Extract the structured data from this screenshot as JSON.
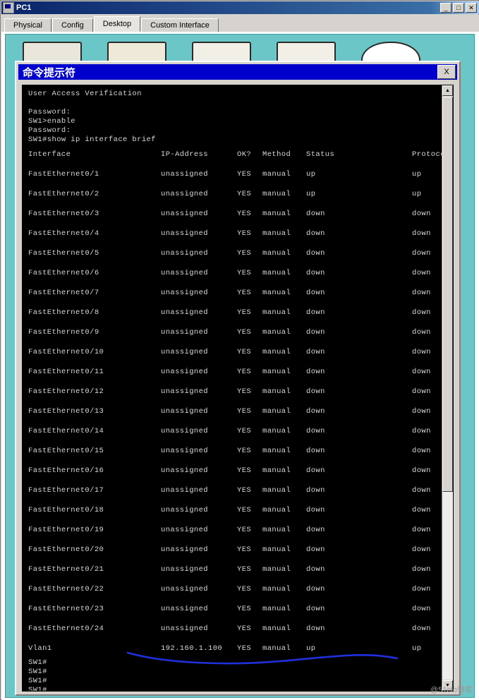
{
  "window": {
    "title": "PC1",
    "buttons": {
      "minimize": "_",
      "maximize": "□",
      "close": "✕"
    }
  },
  "tabs": [
    {
      "label": "Physical",
      "active": false
    },
    {
      "label": "Config",
      "active": false
    },
    {
      "label": "Desktop",
      "active": true
    },
    {
      "label": "Custom Interface",
      "active": false
    }
  ],
  "cmd": {
    "title": "命令提示符",
    "close_label": "X",
    "scroll": {
      "up": "▲",
      "down": "▼"
    }
  },
  "console": {
    "header_lines": [
      "User Access Verification",
      "",
      "Password:",
      "SW1>enable",
      "Password:",
      "SW1#show ip interface brief"
    ],
    "columns": [
      "Interface",
      "IP-Address",
      "OK?",
      "Method",
      "Status",
      "Protocol"
    ],
    "rows": [
      {
        "interface": "FastEthernet0/1",
        "ip": "unassigned",
        "ok": "YES",
        "method": "manual",
        "status": "up",
        "protocol": "up"
      },
      {
        "interface": "FastEthernet0/2",
        "ip": "unassigned",
        "ok": "YES",
        "method": "manual",
        "status": "up",
        "protocol": "up"
      },
      {
        "interface": "FastEthernet0/3",
        "ip": "unassigned",
        "ok": "YES",
        "method": "manual",
        "status": "down",
        "protocol": "down"
      },
      {
        "interface": "FastEthernet0/4",
        "ip": "unassigned",
        "ok": "YES",
        "method": "manual",
        "status": "down",
        "protocol": "down"
      },
      {
        "interface": "FastEthernet0/5",
        "ip": "unassigned",
        "ok": "YES",
        "method": "manual",
        "status": "down",
        "protocol": "down"
      },
      {
        "interface": "FastEthernet0/6",
        "ip": "unassigned",
        "ok": "YES",
        "method": "manual",
        "status": "down",
        "protocol": "down"
      },
      {
        "interface": "FastEthernet0/7",
        "ip": "unassigned",
        "ok": "YES",
        "method": "manual",
        "status": "down",
        "protocol": "down"
      },
      {
        "interface": "FastEthernet0/8",
        "ip": "unassigned",
        "ok": "YES",
        "method": "manual",
        "status": "down",
        "protocol": "down"
      },
      {
        "interface": "FastEthernet0/9",
        "ip": "unassigned",
        "ok": "YES",
        "method": "manual",
        "status": "down",
        "protocol": "down"
      },
      {
        "interface": "FastEthernet0/10",
        "ip": "unassigned",
        "ok": "YES",
        "method": "manual",
        "status": "down",
        "protocol": "down"
      },
      {
        "interface": "FastEthernet0/11",
        "ip": "unassigned",
        "ok": "YES",
        "method": "manual",
        "status": "down",
        "protocol": "down"
      },
      {
        "interface": "FastEthernet0/12",
        "ip": "unassigned",
        "ok": "YES",
        "method": "manual",
        "status": "down",
        "protocol": "down"
      },
      {
        "interface": "FastEthernet0/13",
        "ip": "unassigned",
        "ok": "YES",
        "method": "manual",
        "status": "down",
        "protocol": "down"
      },
      {
        "interface": "FastEthernet0/14",
        "ip": "unassigned",
        "ok": "YES",
        "method": "manual",
        "status": "down",
        "protocol": "down"
      },
      {
        "interface": "FastEthernet0/15",
        "ip": "unassigned",
        "ok": "YES",
        "method": "manual",
        "status": "down",
        "protocol": "down"
      },
      {
        "interface": "FastEthernet0/16",
        "ip": "unassigned",
        "ok": "YES",
        "method": "manual",
        "status": "down",
        "protocol": "down"
      },
      {
        "interface": "FastEthernet0/17",
        "ip": "unassigned",
        "ok": "YES",
        "method": "manual",
        "status": "down",
        "protocol": "down"
      },
      {
        "interface": "FastEthernet0/18",
        "ip": "unassigned",
        "ok": "YES",
        "method": "manual",
        "status": "down",
        "protocol": "down"
      },
      {
        "interface": "FastEthernet0/19",
        "ip": "unassigned",
        "ok": "YES",
        "method": "manual",
        "status": "down",
        "protocol": "down"
      },
      {
        "interface": "FastEthernet0/20",
        "ip": "unassigned",
        "ok": "YES",
        "method": "manual",
        "status": "down",
        "protocol": "down"
      },
      {
        "interface": "FastEthernet0/21",
        "ip": "unassigned",
        "ok": "YES",
        "method": "manual",
        "status": "down",
        "protocol": "down"
      },
      {
        "interface": "FastEthernet0/22",
        "ip": "unassigned",
        "ok": "YES",
        "method": "manual",
        "status": "down",
        "protocol": "down"
      },
      {
        "interface": "FastEthernet0/23",
        "ip": "unassigned",
        "ok": "YES",
        "method": "manual",
        "status": "down",
        "protocol": "down"
      },
      {
        "interface": "FastEthernet0/24",
        "ip": "unassigned",
        "ok": "YES",
        "method": "manual",
        "status": "down",
        "protocol": "down"
      },
      {
        "interface": "Vlan1",
        "ip": "192.160.1.100",
        "ok": "YES",
        "method": "manual",
        "status": "up",
        "protocol": "up"
      }
    ],
    "trailing_lines": [
      "SW1#",
      "SW1#",
      "SW1#",
      "SW1#"
    ]
  },
  "annotation": {
    "color": "#2030dd"
  },
  "watermark": "@51cto博客"
}
